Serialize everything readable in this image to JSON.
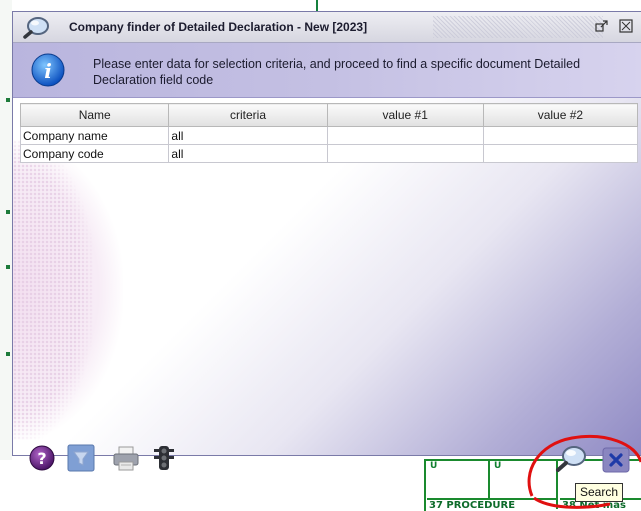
{
  "window": {
    "title": "Company finder of Detailed Declaration - New [2023]"
  },
  "info": {
    "message": "Please enter data for selection criteria, and proceed to find a specific document Detailed Declaration field code"
  },
  "grid": {
    "columns": [
      "Name",
      "criteria",
      "value #1",
      "value #2"
    ],
    "rows": [
      {
        "name": "Company name",
        "criteria": "all",
        "value1": "",
        "value2": ""
      },
      {
        "name": "Company code",
        "criteria": "all",
        "value1": "",
        "value2": ""
      }
    ]
  },
  "toolbar": {
    "buttons": [
      "help-icon",
      "filter-icon",
      "printer-icon",
      "traffic-light-icon",
      "search-icon",
      "close-icon"
    ]
  },
  "tooltip": {
    "text": "Search"
  },
  "background_document": {
    "field_37": "37 PROCEDURE",
    "field_38": "38 Net mas",
    "small_marks": [
      "U",
      "U"
    ]
  },
  "colors": {
    "accent": "#8f8ac4",
    "annotation": "#e01010",
    "document_green": "#1a8a2e"
  }
}
